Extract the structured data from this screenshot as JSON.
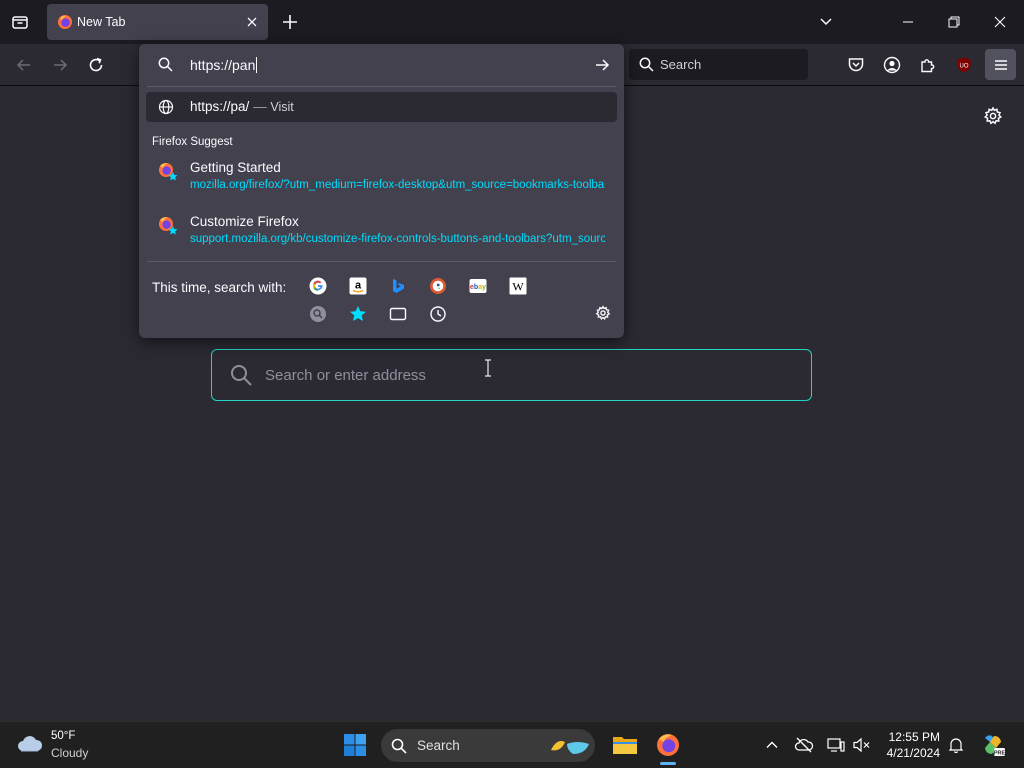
{
  "browser": {
    "tab": {
      "title": "New Tab"
    },
    "toolbar": {
      "search_placeholder": "Search"
    },
    "accent": "#24d4c0",
    "link_color": "#00ddff"
  },
  "urlbar": {
    "typed": "https://pan",
    "visit_result": {
      "url": "https://pa/",
      "dash": "—",
      "action": "Visit"
    },
    "group_label": "Firefox Suggest",
    "suggestions": [
      {
        "title": "Getting Started",
        "url": "mozilla.org/firefox/?utm_medium=firefox-desktop&utm_source=bookmarks-toolbar"
      },
      {
        "title": "Customize Firefox",
        "url": "support.mozilla.org/kb/customize-firefox-controls-buttons-and-toolbars?utm_source"
      }
    ],
    "oneoff_label": "This time, search with:",
    "engines": [
      "google-icon",
      "amazon-icon",
      "bing-icon",
      "duckduckgo-icon",
      "ebay-icon",
      "wikipedia-icon"
    ],
    "modes": [
      "search-engine-mode-icon",
      "bookmarks-mode-icon",
      "tabs-mode-icon",
      "history-mode-icon"
    ]
  },
  "newtab": {
    "search_placeholder": "Search or enter address"
  },
  "taskbar": {
    "weather": {
      "temp": "50°F",
      "desc": "Cloudy"
    },
    "search_label": "Search",
    "clock": {
      "time": "12:55 PM",
      "date": "4/21/2024"
    }
  }
}
